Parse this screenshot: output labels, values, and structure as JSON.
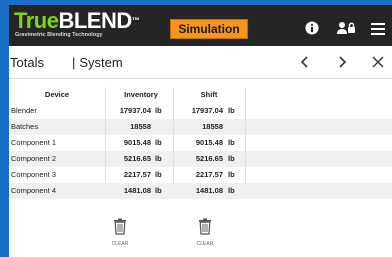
{
  "app": {
    "logo_brand_a": "True",
    "logo_brand_b": "BLEND",
    "logo_tm": "™",
    "logo_tagline": "Gravimetric Blending Technology",
    "mode_button": "Simulation"
  },
  "icons": {
    "info": "info-icon",
    "users": "users-lock-icon",
    "menu": "hamburger-menu-icon",
    "prev": "chevron-left-icon",
    "next": "chevron-right-icon",
    "close": "close-icon",
    "clear": "trash-icon"
  },
  "header": {
    "title": "Totals",
    "separator": "|",
    "subtitle": "System",
    "prev": "‹",
    "next": "›",
    "close": "✕"
  },
  "table": {
    "columns": [
      "Device",
      "Inventory",
      "Shift"
    ],
    "rows": [
      {
        "device": "Blender",
        "inventory": "17937.04",
        "inventory_unit": "lb",
        "shift": "17937.04",
        "shift_unit": "lb"
      },
      {
        "device": "Batches",
        "inventory": "18558",
        "inventory_unit": "",
        "shift": "18558",
        "shift_unit": ""
      },
      {
        "device": "Component 1",
        "inventory": "9015.48",
        "inventory_unit": "lb",
        "shift": "9015.48",
        "shift_unit": "lb"
      },
      {
        "device": "Component 2",
        "inventory": "5216.65",
        "inventory_unit": "lb",
        "shift": "5216.65",
        "shift_unit": "lb"
      },
      {
        "device": "Component 3",
        "inventory": "2217.57",
        "inventory_unit": "lb",
        "shift": "2217.57",
        "shift_unit": "lb"
      },
      {
        "device": "Component 4",
        "inventory": "1481.08",
        "inventory_unit": "lb",
        "shift": "1481.08",
        "shift_unit": "lb"
      }
    ]
  },
  "actions": {
    "clear_inventory": "CLEAR",
    "clear_shift": "CLEAR"
  },
  "colors": {
    "background": "#1a6fc4",
    "topbar": "#252525",
    "mode_button": "#f7941d",
    "logo_accent": "#7ed321",
    "row_alt": "#f0f0f0"
  }
}
